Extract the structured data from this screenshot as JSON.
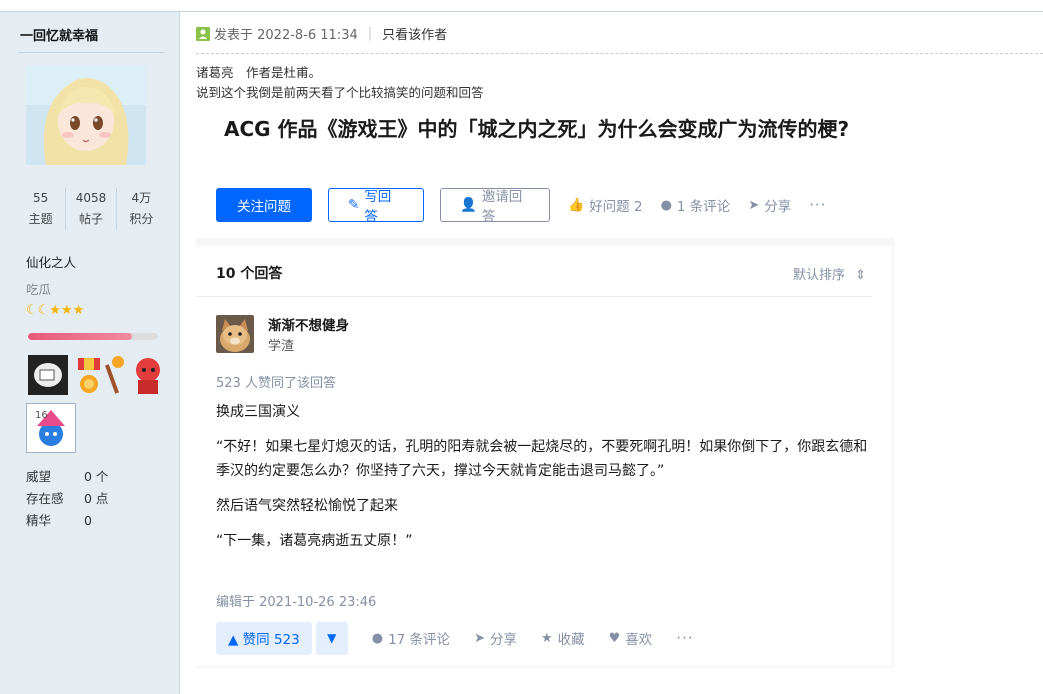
{
  "sidebar": {
    "username": "一回忆就幸福",
    "stats": [
      {
        "value": "55",
        "label": "主题"
      },
      {
        "value": "4058",
        "label": "帖子"
      },
      {
        "value": "4万",
        "label": "积分"
      }
    ],
    "rank": "仙化之人",
    "subrank": "吃瓜",
    "stars": "☾☾★★★",
    "level_progress": 0.8,
    "info": [
      {
        "label": "威望",
        "value": "0 个"
      },
      {
        "label": "存在感",
        "value": "0 点"
      },
      {
        "label": "精华",
        "value": "0"
      }
    ]
  },
  "post": {
    "posted_at": "发表于 2022-8-6 11:34",
    "only_author": "只看该作者",
    "intro_lines": [
      "诸葛亮　作者是杜甫。",
      "说到这个我倒是前两天看了个比较搞笑的问题和回答"
    ]
  },
  "question": {
    "title": "ACG 作品《游戏王》中的「城之内之死」为什么会变成广为流传的梗?",
    "follow_label": "关注问题",
    "write_label": "写回答",
    "invite_label": "邀请回答",
    "good_label": "好问题 2",
    "comment_label": "1 条评论",
    "share_label": "分享",
    "more_label": "···"
  },
  "answers": {
    "count_label": "10 个回答",
    "sort_label": "默认排序",
    "author_name": "渐渐不想健身",
    "author_desc": "学渣",
    "voters": "523 人赞同了该回答",
    "paragraphs": [
      "换成三国演义",
      "“不好！如果七星灯熄灭的话，孔明的阳寿就会被一起烧尽的，不要死啊孔明！如果你倒下了，你跟玄德和季汉的约定要怎么办？你坚持了六天，撑过今天就肯定能击退司马懿了。”",
      "然后语气突然轻松愉悦了起来",
      "“下一集，诸葛亮病逝五丈原！”"
    ],
    "edited": "编辑于 2021-10-26 23:46",
    "vote_up_label": "▲ 赞同 523",
    "vote_down_label": "▼",
    "comments_label": "17 条评论",
    "share_label": "分享",
    "collect_label": "收藏",
    "like_label": "喜欢",
    "more_label": "···"
  }
}
